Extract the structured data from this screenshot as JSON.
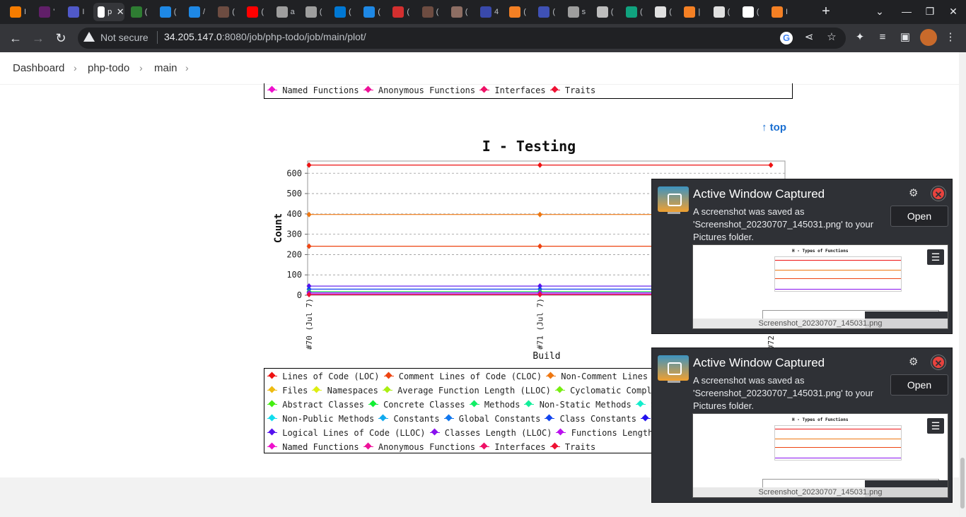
{
  "browser": {
    "tabs": [
      {
        "title": "I",
        "color": "#f57c00"
      },
      {
        "title": "'",
        "color": "#611f69"
      },
      {
        "title": "I",
        "color": "#5059c9"
      },
      {
        "title": "p",
        "color": "#ffffff",
        "active": true
      },
      {
        "title": "(",
        "color": "#2e7d32"
      },
      {
        "title": "(",
        "color": "#1e88e5"
      },
      {
        "title": "/",
        "color": "#1e88e5"
      },
      {
        "title": "(",
        "color": "#6d4c41"
      },
      {
        "title": "(",
        "color": "#ff0000"
      },
      {
        "title": "a",
        "color": "#9e9e9e"
      },
      {
        "title": "(",
        "color": "#9e9e9e"
      },
      {
        "title": "(",
        "color": "#0078d4"
      },
      {
        "title": "(",
        "color": "#1e88e5"
      },
      {
        "title": "(",
        "color": "#d32f2f"
      },
      {
        "title": "(",
        "color": "#6d4c41"
      },
      {
        "title": "(",
        "color": "#8d6e63"
      },
      {
        "title": "4",
        "color": "#3949ab"
      },
      {
        "title": "(",
        "color": "#f48024"
      },
      {
        "title": "(",
        "color": "#3f51b5"
      },
      {
        "title": "s",
        "color": "#9e9e9e"
      },
      {
        "title": "(",
        "color": "#bdbdbd"
      },
      {
        "title": "(",
        "color": "#10a37f"
      },
      {
        "title": "(",
        "color": "#e0e0e0"
      },
      {
        "title": "|",
        "color": "#f48024"
      },
      {
        "title": "(",
        "color": "#e0e0e0"
      },
      {
        "title": "(",
        "color": "#ffffff"
      },
      {
        "title": "I",
        "color": "#f48024"
      }
    ],
    "new_tab": "+",
    "close_tab": "✕",
    "not_secure": "Not secure",
    "url_host": "34.205.147.0",
    "url_path": ":8080/job/php-todo/job/main/plot/"
  },
  "breadcrumb": {
    "items": [
      "Dashboard",
      "php-todo",
      "main"
    ]
  },
  "top_legend": {
    "items": [
      {
        "label": "Named Functions",
        "color": "#ee11cc"
      },
      {
        "label": "Anonymous Functions",
        "color": "#ee1199"
      },
      {
        "label": "Interfaces",
        "color": "#ee1166"
      },
      {
        "label": "Traits",
        "color": "#ee1133"
      }
    ]
  },
  "top_link": "top",
  "chart_data": {
    "type": "line",
    "title": "I - Testing",
    "xlabel": "Build",
    "ylabel": "Count",
    "categories": [
      "#70 (Jul 7)",
      "#71 (Jul 7)",
      "#72 (Jul 7)"
    ],
    "ylim": [
      0,
      660
    ],
    "yticks": [
      0,
      100,
      200,
      300,
      400,
      500,
      600
    ],
    "grid": true,
    "series": [
      {
        "name": "Lines of Code (LOC)",
        "color": "#ee1111",
        "values": [
          640,
          640,
          640
        ]
      },
      {
        "name": "Non-Comment Lines of Code",
        "color": "#ee7711",
        "values": [
          397,
          397,
          397
        ]
      },
      {
        "name": "Comment Lines of Code (CLOC)",
        "color": "#ee4411",
        "values": [
          241,
          241,
          241
        ]
      },
      {
        "name": "Logical Lines of Code (LLOC)",
        "color": "#5511ee",
        "values": [
          45,
          45,
          45
        ]
      },
      {
        "name": "Class Constants",
        "color": "#1144ee",
        "values": [
          30,
          30,
          30
        ]
      },
      {
        "name": "Methods",
        "color": "#11cc55",
        "values": [
          18,
          18,
          18
        ]
      },
      {
        "name": "Classes Length (LLOC)",
        "color": "#8811ee",
        "values": [
          12,
          12,
          12
        ]
      },
      {
        "name": "Functions Length (LLOC)",
        "color": "#bb11ee",
        "values": [
          6,
          6,
          6
        ]
      },
      {
        "name": "Traits",
        "color": "#ee1133",
        "values": [
          3,
          3,
          3
        ]
      }
    ]
  },
  "bottom_legend": {
    "rows": [
      [
        {
          "label": "Lines of Code (LOC)",
          "color": "#ee1111"
        },
        {
          "label": "Comment Lines of Code (CLOC)",
          "color": "#ee4411"
        },
        {
          "label": "Non-Comment Lines of C",
          "color": "#ee7711"
        }
      ],
      [
        {
          "label": "Files",
          "color": "#eebb11"
        },
        {
          "label": "Namespaces",
          "color": "#ddee11"
        },
        {
          "label": "Average Function Length (LLOC)",
          "color": "#aaee11"
        },
        {
          "label": "Cyclomatic Complexit",
          "color": "#77ee11"
        }
      ],
      [
        {
          "label": "Abstract Classes",
          "color": "#44ee11"
        },
        {
          "label": "Concrete Classes",
          "color": "#11ee33"
        },
        {
          "label": "Methods",
          "color": "#11ee66"
        },
        {
          "label": "Non-Static Methods",
          "color": "#11ee99"
        },
        {
          "label": "Stati",
          "color": "#11eecc"
        }
      ],
      [
        {
          "label": "Non-Public Methods",
          "color": "#11ddee"
        },
        {
          "label": "Constants",
          "color": "#11aaee"
        },
        {
          "label": "Global Constants",
          "color": "#1177ee"
        },
        {
          "label": "Class Constants",
          "color": "#1144ee"
        },
        {
          "label": "Tes",
          "color": "#2211ee"
        }
      ],
      [
        {
          "label": "Logical Lines of Code (LLOC)",
          "color": "#5511ee"
        },
        {
          "label": "Classes Length (LLOC)",
          "color": "#8811ee"
        },
        {
          "label": "Functions Length (L",
          "color": "#bb11ee"
        }
      ],
      [
        {
          "label": "Named Functions",
          "color": "#ee11cc"
        },
        {
          "label": "Anonymous Functions",
          "color": "#ee1199"
        },
        {
          "label": "Interfaces",
          "color": "#ee1166"
        },
        {
          "label": "Traits",
          "color": "#ee1133"
        }
      ]
    ]
  },
  "notifications": [
    {
      "title": "Active Window Captured",
      "body": "A screenshot was saved as 'Screenshot_20230707_145031.png' to your Pictures folder.",
      "open_label": "Open",
      "thumb_caption": "Screenshot_20230707_145031.png",
      "thumb_title": "H - Types of Functions"
    },
    {
      "title": "Active Window Captured",
      "body": "A screenshot was saved as 'Screenshot_20230707_145031.png' to your Pictures folder.",
      "open_label": "Open",
      "thumb_caption": "Screenshot_20230707_145031.png",
      "thumb_title": "H - Types of Functions"
    }
  ]
}
